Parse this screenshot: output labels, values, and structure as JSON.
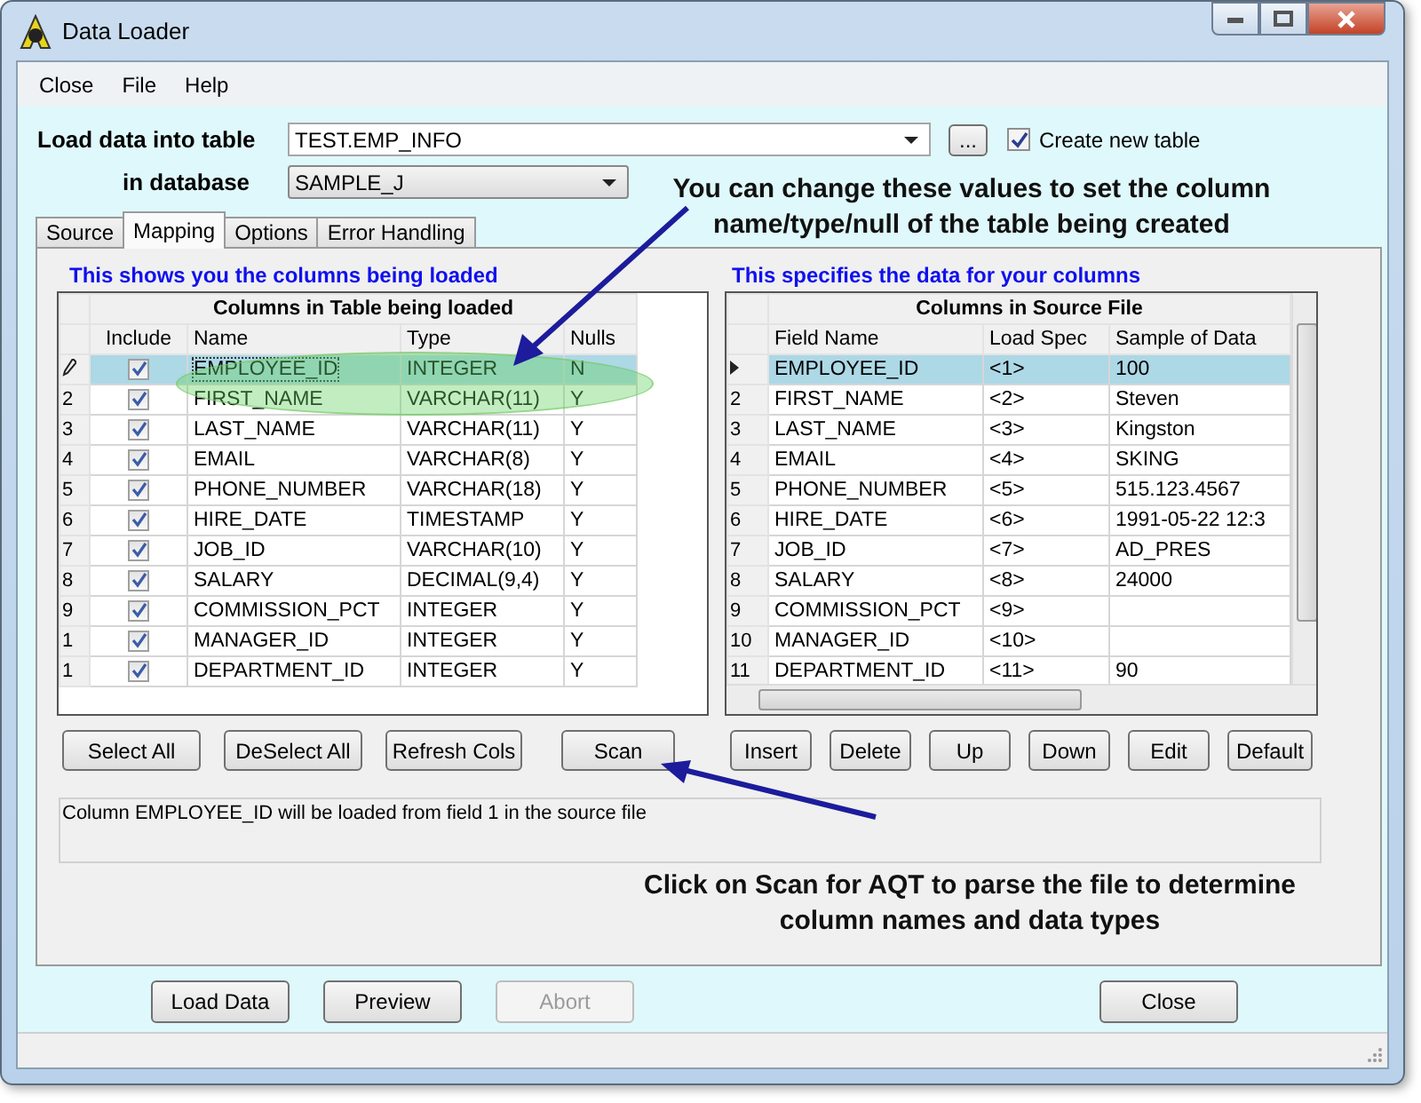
{
  "window": {
    "title": "Data Loader"
  },
  "menu": [
    "Close",
    "File",
    "Help"
  ],
  "target": {
    "table_label": "Load data into table",
    "table_value": "TEST.EMP_INFO",
    "browse_button": "...",
    "create_new_table": {
      "label": "Create new table",
      "checked": true
    },
    "database_label": "in database",
    "database_value": "SAMPLE_J"
  },
  "tabs": [
    {
      "label": "Source",
      "selected": false
    },
    {
      "label": "Mapping",
      "selected": true
    },
    {
      "label": "Options",
      "selected": false
    },
    {
      "label": "Error Handling",
      "selected": false
    }
  ],
  "left_panel": {
    "caption": "This shows you the columns being loaded",
    "grid": {
      "title": "Columns in Table being loaded",
      "columns": [
        "Include",
        "Name",
        "Type",
        "Nulls"
      ],
      "rows": [
        {
          "selected": true,
          "include": true,
          "name": "EMPLOYEE_ID",
          "type": "INTEGER",
          "nulls": "N"
        },
        {
          "row_header": "2",
          "selected": false,
          "include": true,
          "name": "FIRST_NAME",
          "type": "VARCHAR(11)",
          "nulls": "Y"
        },
        {
          "row_header": "3",
          "selected": false,
          "include": true,
          "name": "LAST_NAME",
          "type": "VARCHAR(11)",
          "nulls": "Y"
        },
        {
          "row_header": "4",
          "selected": false,
          "include": true,
          "name": "EMAIL",
          "type": "VARCHAR(8)",
          "nulls": "Y"
        },
        {
          "row_header": "5",
          "selected": false,
          "include": true,
          "name": "PHONE_NUMBER",
          "type": "VARCHAR(18)",
          "nulls": "Y"
        },
        {
          "row_header": "6",
          "selected": false,
          "include": true,
          "name": "HIRE_DATE",
          "type": "TIMESTAMP",
          "nulls": "Y"
        },
        {
          "row_header": "7",
          "selected": false,
          "include": true,
          "name": "JOB_ID",
          "type": "VARCHAR(10)",
          "nulls": "Y"
        },
        {
          "row_header": "8",
          "selected": false,
          "include": true,
          "name": "SALARY",
          "type": "DECIMAL(9,4)",
          "nulls": "Y"
        },
        {
          "row_header": "9",
          "selected": false,
          "include": true,
          "name": "COMMISSION_PCT",
          "type": "INTEGER",
          "nulls": "Y"
        },
        {
          "row_header": "1",
          "selected": false,
          "include": true,
          "name": "MANAGER_ID",
          "type": "INTEGER",
          "nulls": "Y"
        },
        {
          "row_header": "1",
          "selected": false,
          "include": true,
          "name": "DEPARTMENT_ID",
          "type": "INTEGER",
          "nulls": "Y"
        }
      ]
    },
    "buttons": [
      "Select All",
      "DeSelect All",
      "Refresh Cols",
      "Scan"
    ]
  },
  "right_panel": {
    "caption": "This specifies the data for your columns",
    "grid": {
      "title": "Columns in Source File",
      "columns": [
        "Field Name",
        "Load Spec",
        "Sample of Data"
      ],
      "rows": [
        {
          "selected": true,
          "field_name": "EMPLOYEE_ID",
          "load_spec": "<1>",
          "sample": "100"
        },
        {
          "row_header": "2",
          "selected": false,
          "field_name": "FIRST_NAME",
          "load_spec": "<2>",
          "sample": "Steven"
        },
        {
          "row_header": "3",
          "selected": false,
          "field_name": "LAST_NAME",
          "load_spec": "<3>",
          "sample": "Kingston"
        },
        {
          "row_header": "4",
          "selected": false,
          "field_name": "EMAIL",
          "load_spec": "<4>",
          "sample": "SKING"
        },
        {
          "row_header": "5",
          "selected": false,
          "field_name": "PHONE_NUMBER",
          "load_spec": "<5>",
          "sample": "515.123.4567"
        },
        {
          "row_header": "6",
          "selected": false,
          "field_name": "HIRE_DATE",
          "load_spec": "<6>",
          "sample": "1991-05-22 12:3"
        },
        {
          "row_header": "7",
          "selected": false,
          "field_name": "JOB_ID",
          "load_spec": "<7>",
          "sample": "AD_PRES"
        },
        {
          "row_header": "8",
          "selected": false,
          "field_name": "SALARY",
          "load_spec": "<8>",
          "sample": "24000"
        },
        {
          "row_header": "9",
          "selected": false,
          "field_name": "COMMISSION_PCT",
          "load_spec": "<9>"
        },
        {
          "row_header": "10",
          "selected": false,
          "field_name": "MANAGER_ID",
          "load_spec": "<10>"
        },
        {
          "row_header": "11",
          "selected": false,
          "field_name": "DEPARTMENT_ID",
          "load_spec": "<11>",
          "sample": "90"
        }
      ]
    },
    "buttons": [
      "Insert",
      "Delete",
      "Up",
      "Down",
      "Edit",
      "Default"
    ]
  },
  "message": "Column EMPLOYEE_ID will be loaded from field 1 in the source file",
  "bottom_buttons": [
    {
      "label": "Load Data",
      "disabled": false
    },
    {
      "label": "Preview",
      "disabled": false
    },
    {
      "label": "Abort",
      "disabled": true
    },
    {
      "label": "Close",
      "disabled": false
    }
  ],
  "annotations": [
    "You can change these values to set the column name/type/null of the table being created",
    "Click on Scan for AQT to parse the file to determine column names and data types"
  ]
}
